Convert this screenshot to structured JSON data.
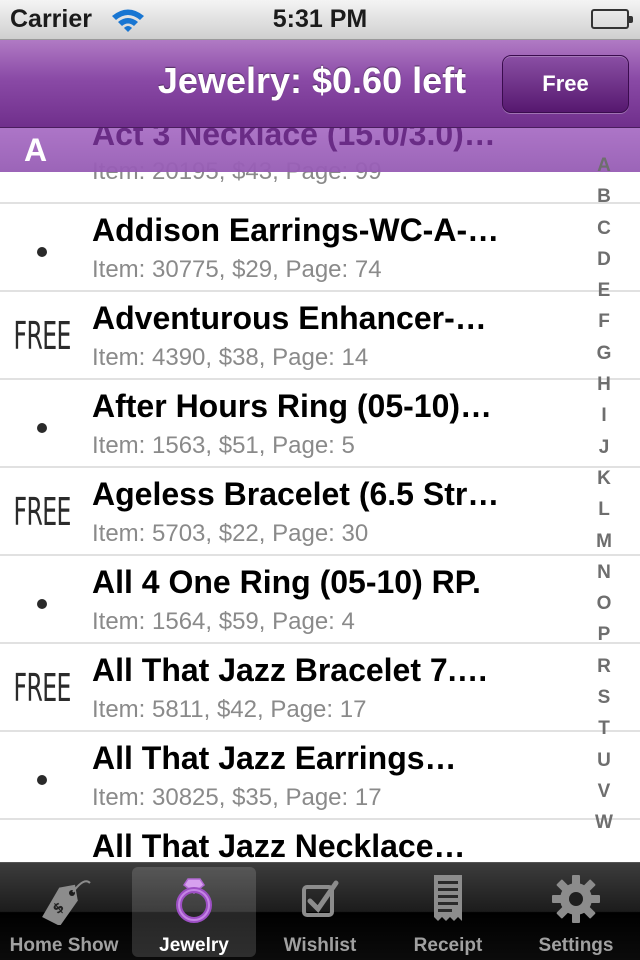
{
  "status_bar": {
    "carrier": "Carrier",
    "time": "5:31 PM",
    "battery_icon": "battery-full-icon",
    "wifi_icon": "wifi-icon"
  },
  "nav": {
    "title": "Jewelry: $0.60 left",
    "free_button": "Free",
    "accent_color": "#7e3d9c"
  },
  "list": {
    "section_letter": "A",
    "rows": [
      {
        "marker": "",
        "name": "Act 3 Necklace (15.0/3.0)…",
        "meta": "Item: 20195, $43, Page: 99"
      },
      {
        "marker": "bullet",
        "name": "Addison Earrings-WC-A-…",
        "meta": "Item: 30775, $29, Page: 74"
      },
      {
        "marker": "free",
        "free_text": "FREE",
        "name": "Adventurous Enhancer-…",
        "meta": "Item: 4390, $38, Page: 14"
      },
      {
        "marker": "bullet",
        "name": "After Hours Ring (05-10)…",
        "meta": "Item: 1563, $51, Page: 5"
      },
      {
        "marker": "free",
        "free_text": "FREE",
        "name": "Ageless Bracelet (6.5 Str…",
        "meta": "Item: 5703, $22, Page: 30"
      },
      {
        "marker": "bullet",
        "name": "All 4 One Ring (05-10) RP.",
        "meta": "Item: 1564, $59, Page: 4"
      },
      {
        "marker": "free",
        "free_text": "FREE",
        "name": "All That Jazz Bracelet 7.…",
        "meta": "Item: 5811, $42, Page: 17"
      },
      {
        "marker": "bullet",
        "name": "All That Jazz Earrings…",
        "meta": "Item: 30825, $35, Page: 17"
      },
      {
        "marker": "bullet",
        "name": "All That Jazz Necklace…",
        "meta": ""
      }
    ]
  },
  "index_letters": [
    "A",
    "B",
    "C",
    "D",
    "E",
    "F",
    "G",
    "H",
    "I",
    "J",
    "K",
    "L",
    "M",
    "N",
    "O",
    "P",
    "R",
    "S",
    "T",
    "U",
    "V",
    "W"
  ],
  "tabs": [
    {
      "label": "Home Show",
      "icon": "price-tag-icon",
      "active": false
    },
    {
      "label": "Jewelry",
      "icon": "ring-icon",
      "active": true
    },
    {
      "label": "Wishlist",
      "icon": "checkbox-icon",
      "active": false
    },
    {
      "label": "Receipt",
      "icon": "receipt-icon",
      "active": false
    },
    {
      "label": "Settings",
      "icon": "gear-icon",
      "active": false
    }
  ]
}
